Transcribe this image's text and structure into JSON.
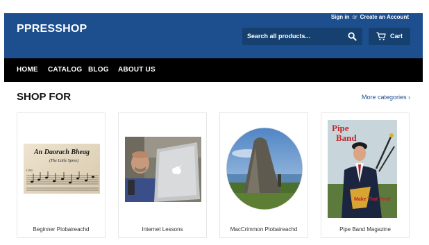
{
  "header": {
    "logo": "PPRESSHOP",
    "sign_in": "Sign in",
    "or": "or",
    "create_account": "Create an Account",
    "search_placeholder": "Search all products...",
    "cart_label": "Cart"
  },
  "nav": {
    "items": [
      "HOME",
      "CATALOG",
      "BLOG",
      "ABOUT US"
    ]
  },
  "section": {
    "title": "SHOP FOR",
    "more_link": "More categories ›"
  },
  "collections": [
    {
      "label": "Beginner Piobaireachd",
      "image_text_line1": "An Daorach Bheag",
      "image_text_line2": "(The Little Spree)"
    },
    {
      "label": "Internet Lessons"
    },
    {
      "label": "MacCrimmon Piobaireachd"
    },
    {
      "label": "Pipe Band Magazine",
      "image_text_line1": "Pipe",
      "image_text_line2": "Band",
      "image_text_line3": "Make That Tent!"
    }
  ],
  "colors": {
    "header_bg": "#1d4f8f",
    "nav_bg": "#000000",
    "accent": "#1d4f8f"
  }
}
